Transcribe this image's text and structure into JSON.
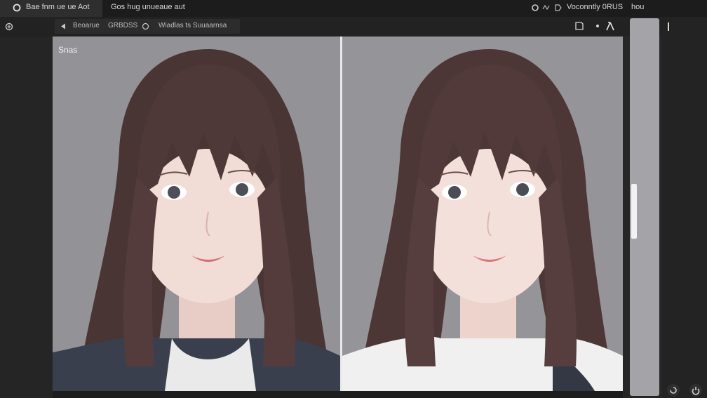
{
  "titlebar": {
    "tabs": [
      "Bae fnm ue ue Aot",
      "Gos hug unueaue aut"
    ],
    "status_text": "Voconntly 0RUS",
    "menu_label": "hou"
  },
  "breadcrumb": {
    "back_label": "Beoarue",
    "section": "GRBDSS",
    "path": "Wiadlas ts Suuaarnsa"
  },
  "compare": {
    "left_label": "Snas"
  },
  "colors": {
    "background": "#929196",
    "divider": "#e9e9ec",
    "chrome": "#1c1c1c"
  },
  "icons": [
    "app-logo-icon",
    "settings-icon",
    "wave-icon",
    "pin-icon",
    "back-arrow-icon",
    "info-icon",
    "square-icon",
    "dot-icon",
    "lambda-icon",
    "refresh-icon",
    "power-icon"
  ]
}
